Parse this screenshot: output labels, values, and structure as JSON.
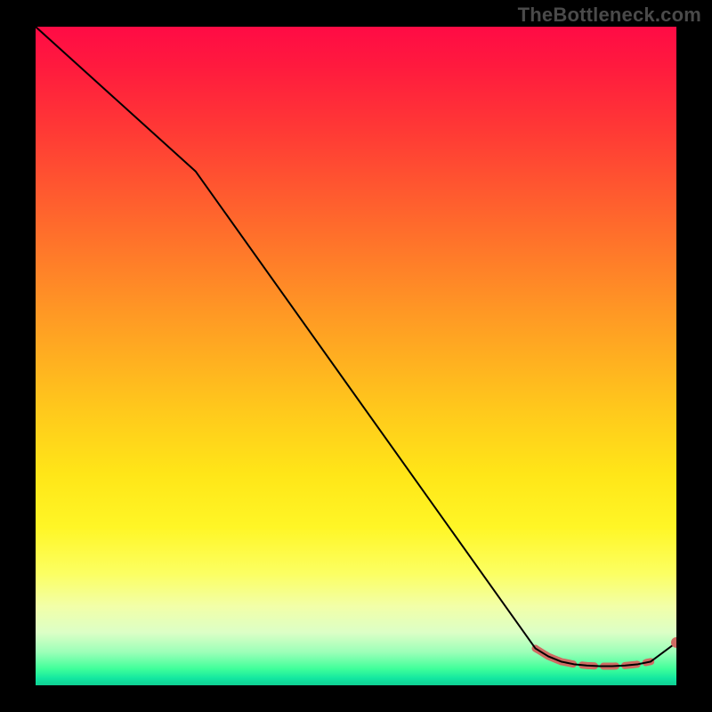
{
  "watermark": "TheBottleneck.com",
  "chart_data": {
    "type": "line",
    "title": "",
    "xlabel": "",
    "ylabel": "",
    "xlim": [
      0,
      100
    ],
    "ylim": [
      0,
      100
    ],
    "grid": false,
    "legend": false,
    "series": [
      {
        "name": "main-curve",
        "color": "#000000",
        "stroke_width": 2,
        "x": [
          0,
          25,
          78,
          80,
          82,
          84,
          86,
          88,
          90,
          92,
          94,
          96,
          100
        ],
        "values": [
          100,
          78,
          5.6,
          4.4,
          3.6,
          3.2,
          3.0,
          2.9,
          2.9,
          3.0,
          3.2,
          3.6,
          6.5
        ]
      }
    ],
    "highlight_segments": [
      {
        "from_x": 78,
        "to_x": 82,
        "solid": true
      },
      {
        "from_x": 82,
        "to_x": 96,
        "solid": false
      }
    ],
    "highlight_style": {
      "color": "#cf6b63",
      "width": 8,
      "dash": "14 10"
    },
    "end_point": {
      "x": 100,
      "y": 6.5,
      "r": 6,
      "color": "#cf6b63"
    }
  }
}
